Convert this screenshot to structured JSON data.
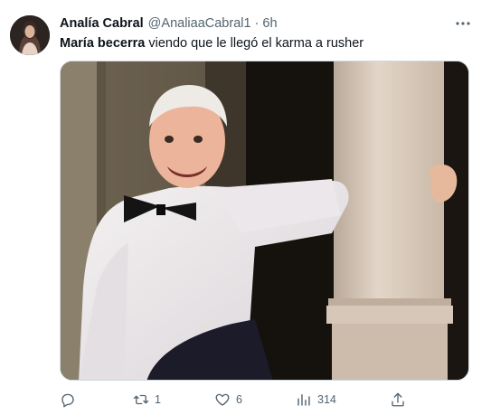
{
  "tweet": {
    "display_name": "Analía Cabral",
    "handle": "@AnaliaaCabral1",
    "separator": "·",
    "time": "6h",
    "text_bold": "María becerra",
    "text_rest": " viendo que le llegó el karma a rusher"
  },
  "actions": {
    "reply_count": "",
    "retweet_count": "1",
    "like_count": "6",
    "views_count": "314"
  },
  "icons": {
    "more": "more-icon",
    "reply": "reply-icon",
    "retweet": "retweet-icon",
    "like": "heart-icon",
    "views": "views-icon",
    "share": "share-icon"
  },
  "colors": {
    "text_primary": "#0f1419",
    "text_secondary": "#536471",
    "border": "#cfd9de"
  }
}
